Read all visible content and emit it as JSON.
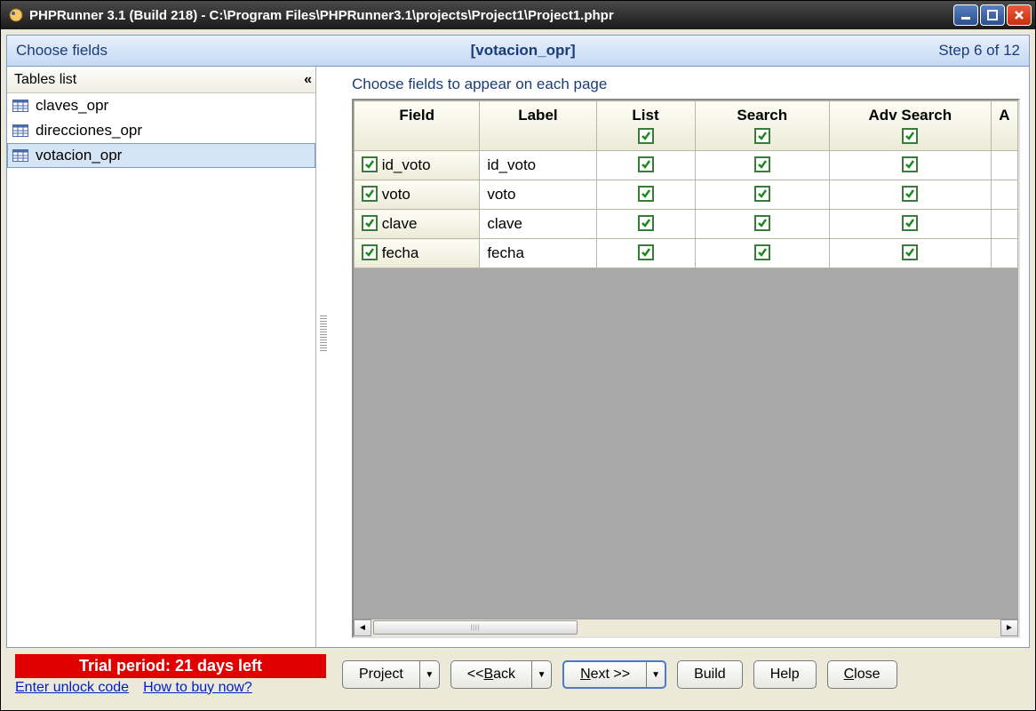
{
  "window": {
    "title": "PHPRunner 3.1 (Build 218) - C:\\Program Files\\PHPRunner3.1\\projects\\Project1\\Project1.phpr"
  },
  "header": {
    "left": "Choose fields",
    "mid": "[votacion_opr]",
    "right": "Step 6 of 12"
  },
  "sidebar": {
    "title": "Tables list",
    "items": [
      {
        "name": "claves_opr",
        "selected": false
      },
      {
        "name": "direcciones_opr",
        "selected": false
      },
      {
        "name": "votacion_opr",
        "selected": true
      }
    ]
  },
  "right": {
    "caption": "Choose fields to appear on each page",
    "columns": {
      "field": "Field",
      "label": "Label",
      "list": "List",
      "search": "Search",
      "adv": "Adv Search",
      "last": "A"
    },
    "header_checks": {
      "list": true,
      "search": true,
      "adv": true
    },
    "rows": [
      {
        "field": "id_voto",
        "label": "id_voto",
        "chk": true,
        "list": true,
        "search": true,
        "adv": true
      },
      {
        "field": "voto",
        "label": "voto",
        "chk": true,
        "list": true,
        "search": true,
        "adv": true
      },
      {
        "field": "clave",
        "label": "clave",
        "chk": true,
        "list": true,
        "search": true,
        "adv": true
      },
      {
        "field": "fecha",
        "label": "fecha",
        "chk": true,
        "list": true,
        "search": true,
        "adv": true
      }
    ]
  },
  "footer": {
    "trial": "Trial period: 21 days left",
    "link1": "Enter unlock code",
    "link2": "How to buy now?",
    "project": "Project",
    "back_pre": "<< ",
    "back_u": "B",
    "back_post": "ack",
    "next_u": "N",
    "next_post": "ext >>",
    "build": "Build",
    "help": "Help",
    "close_u": "C",
    "close_post": "lose"
  }
}
